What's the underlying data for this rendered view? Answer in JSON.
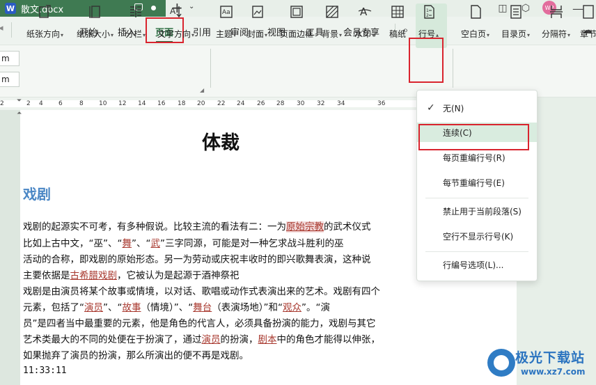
{
  "titlebar": {
    "doc_name": "散文.docx",
    "w_logo": "W",
    "avatar": "WP"
  },
  "menu": {
    "tabs": [
      "开始",
      "插入",
      "页面",
      "引用",
      "审阅",
      "视图",
      "工具",
      "会员专享"
    ],
    "active_index": 2
  },
  "ribbon": {
    "page_inputs": [
      "m",
      "m"
    ],
    "buttons": [
      "纸张方向",
      "纸张大小",
      "分栏",
      "文字方向",
      "主题",
      "封面",
      "页面边框",
      "背景",
      "水印",
      "稿纸",
      "行号",
      "空白页",
      "目录页",
      "分隔符",
      "章节"
    ]
  },
  "ruler": {
    "numbers": [
      "2",
      "2",
      "4",
      "6",
      "8",
      "10",
      "12",
      "14",
      "16",
      "18",
      "20",
      "22",
      "24",
      "26",
      "28",
      "30",
      "32",
      "34",
      "36"
    ]
  },
  "document": {
    "title": "体裁",
    "heading": "戏剧",
    "lines": [
      [
        {
          "t": "戏剧的起源实不可考，有多种假说。比较主流的看法有二：一为"
        },
        {
          "t": "原始宗教",
          "k": "linkhl"
        },
        {
          "t": "的武术仪式"
        }
      ],
      [
        {
          "t": "比如上古中文，“巫”、“"
        },
        {
          "t": "舞",
          "k": "link"
        },
        {
          "t": "”、“"
        },
        {
          "t": "武",
          "k": "link"
        },
        {
          "t": "”三字同源，可能是对一种乞求战斗胜利的巫"
        }
      ],
      [
        {
          "t": "活动的合称，即戏剧的原始形态。另一为劳动或庆祝丰收时的即兴歌舞表演，这种说"
        }
      ],
      [
        {
          "t": "主要依据是"
        },
        {
          "t": "古希腊戏剧",
          "k": "link"
        },
        {
          "t": "，它被认为是起源于酒神祭祀"
        }
      ],
      [
        {
          "t": "戏剧是由演员将某个故事或情境，以对话、歌唱或动作式表演出来的艺术。戏剧有四个"
        }
      ],
      [
        {
          "t": "元素，包括了“"
        },
        {
          "t": "演员",
          "k": "link"
        },
        {
          "t": "”、“"
        },
        {
          "t": "故事",
          "k": "link"
        },
        {
          "t": "（情境）”、“"
        },
        {
          "t": "舞台",
          "k": "link"
        },
        {
          "t": "（表演场地）”和“"
        },
        {
          "t": "观众",
          "k": "link"
        },
        {
          "t": "”。“演"
        }
      ],
      [
        {
          "t": "员”是四者当中最重要的元素，他是角色的代言人，必须具备扮演的能力，戏剧与其它"
        }
      ],
      [
        {
          "t": "艺术类最大的不同的处便在于扮演了，通过"
        },
        {
          "t": "演员",
          "k": "link"
        },
        {
          "t": "的扮演，"
        },
        {
          "t": "剧本",
          "k": "link"
        },
        {
          "t": "中的角色才能得以伸张，"
        }
      ],
      [
        {
          "t": "如果抛弃了演员的扮演，那么所演出的便不再是戏剧。"
        }
      ]
    ],
    "time": "11:33:11"
  },
  "dropdown": {
    "items": [
      {
        "label": "无(N)",
        "checked": true
      },
      {
        "label": "连续(C)",
        "selected": true
      },
      {
        "label": "每页重编行号(R)"
      },
      {
        "label": "每节重编行号(E)"
      },
      {
        "label": "禁止用于当前段落(S)"
      },
      {
        "label": "空行不显示行号(K)"
      },
      {
        "label": "行编号选项(L)..."
      }
    ]
  },
  "watermark": {
    "title": "极光下载站",
    "url": "www.xz7.com"
  },
  "colors": {
    "accent": "#2d6e43",
    "tab_bg": "#3f7a52",
    "highlight": "#d9242e",
    "heading": "#4b87c5",
    "link": "#a8382e"
  }
}
